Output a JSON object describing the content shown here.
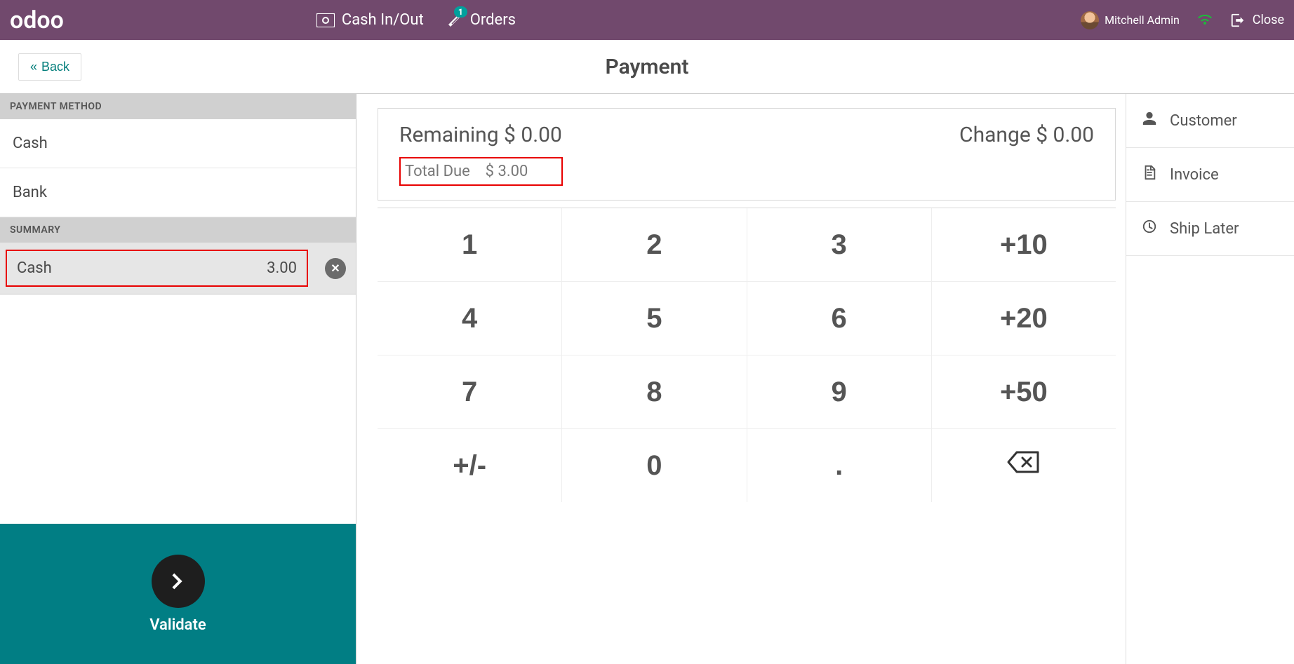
{
  "topbar": {
    "brand": "odoo",
    "cash_in_out": "Cash In/Out",
    "orders_label": "Orders",
    "orders_badge": "1",
    "user_name": "Mitchell Admin",
    "close_label": "Close"
  },
  "subheader": {
    "back_label": "Back",
    "page_title": "Payment"
  },
  "left": {
    "payment_method_heading": "PAYMENT METHOD",
    "methods": {
      "cash": "Cash",
      "bank": "Bank"
    },
    "summary_heading": "SUMMARY",
    "summary_line": {
      "method": "Cash",
      "amount": "3.00"
    },
    "validate_label": "Validate"
  },
  "center": {
    "remaining_label": "Remaining",
    "remaining_value": "$ 0.00",
    "change_label": "Change",
    "change_value": "$ 0.00",
    "total_due_label": "Total Due",
    "total_due_value": "$ 3.00",
    "keys": {
      "k1": "1",
      "k2": "2",
      "k3": "3",
      "k_p10": "+10",
      "k4": "4",
      "k5": "5",
      "k6": "6",
      "k_p20": "+20",
      "k7": "7",
      "k8": "8",
      "k9": "9",
      "k_p50": "+50",
      "k_pm": "+/-",
      "k0": "0",
      "k_dot": "."
    }
  },
  "right": {
    "customer": "Customer",
    "invoice": "Invoice",
    "ship_later": "Ship Later"
  }
}
